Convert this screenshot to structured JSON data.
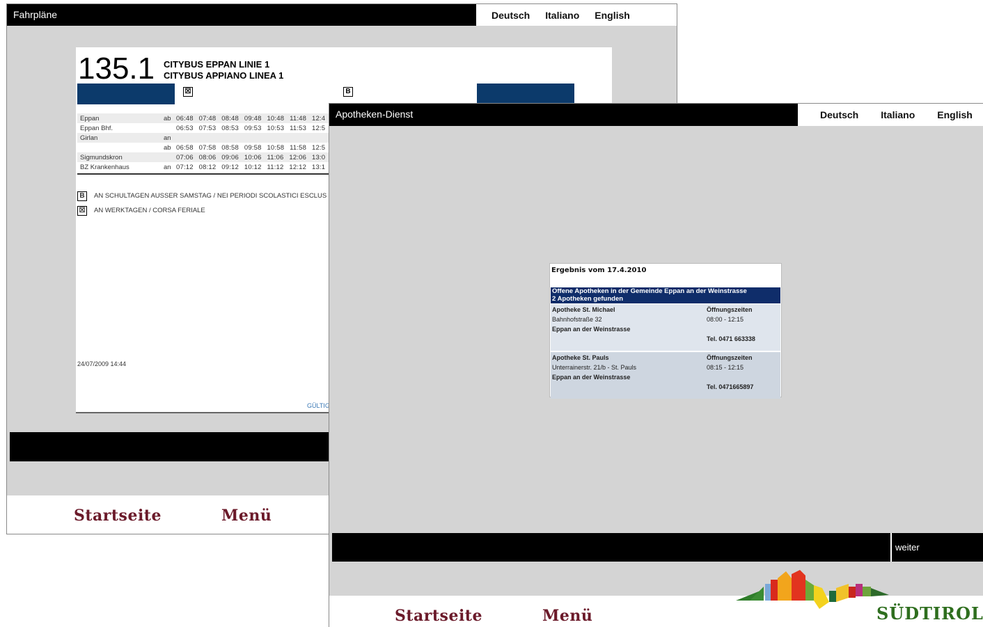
{
  "window1": {
    "title": "Fahrpläne",
    "languages": [
      "Deutsch",
      "Italiano",
      "English"
    ],
    "document": {
      "line_number": "135.1",
      "line_name_de": "CITYBUS EPPAN LINIE 1",
      "line_name_it": "CITYBUS APPIANO LINEA 1",
      "header_marks": [
        "☒",
        "B"
      ],
      "stops": [
        {
          "name": "Eppan",
          "mark": "ab",
          "times": "06:48 07:48 08:48 09:48 10:48 11:48 12:4"
        },
        {
          "name": "Eppan Bhf.",
          "mark": "",
          "times": "06:53 07:53 08:53 09:53 10:53 11:53 12:5"
        },
        {
          "name": "Girlan",
          "mark": "an",
          "times": ""
        },
        {
          "name": "",
          "mark": "ab",
          "times": "06:58 07:58 08:58 09:58 10:58 11:58 12:5"
        },
        {
          "name": "Sigmundskron",
          "mark": "",
          "times": "07:06 08:06 09:06 10:06 11:06 12:06 13:0"
        },
        {
          "name": "BZ Krankenhaus",
          "mark": "an",
          "times": "07:12 08:12 09:12 10:12 11:12 12:12 13:1"
        }
      ],
      "notes": [
        {
          "mark": "B",
          "text": "AN SCHULTAGEN AUSSER SAMSTAG / NEI PERIODI SCOLASTICI ESCLUS"
        },
        {
          "mark": "☒",
          "text": "AN WERKTAGEN / CORSA FERIALE"
        }
      ],
      "date": "24/07/2009 14:44",
      "link": "GÜLTIG"
    },
    "nav": {
      "home": "Startseite",
      "menu": "Menü"
    }
  },
  "window2": {
    "title": "Apotheken-Dienst",
    "languages": [
      "Deutsch",
      "Italiano",
      "English"
    ],
    "result": {
      "title": "Ergebnis vom 17.4.2010",
      "header_line1": "Offene Apotheken in der Gemeinde Eppan an der Weinstrasse",
      "header_line2": "2 Apotheken gefunden",
      "pharmacies": [
        {
          "name": "Apotheke St. Michael",
          "address": "Bahnhofstraße 32",
          "community": "Eppan an der Weinstrasse",
          "hours_label": "Öffnungszeiten",
          "hours": "08:00 - 12:15",
          "phone": "Tel. 0471 663338"
        },
        {
          "name": "Apotheke St. Pauls",
          "address": "Unterrainerstr. 21/b - St. Pauls",
          "community": "Eppan an der Weinstrasse",
          "hours_label": "Öffnungszeiten",
          "hours": "08:15 - 12:15",
          "phone": "Tel. 0471665897"
        }
      ]
    },
    "next_button": "weiter",
    "nav": {
      "home": "Startseite",
      "menu": "Menü"
    },
    "logo_text": "SÜDTIROL"
  }
}
